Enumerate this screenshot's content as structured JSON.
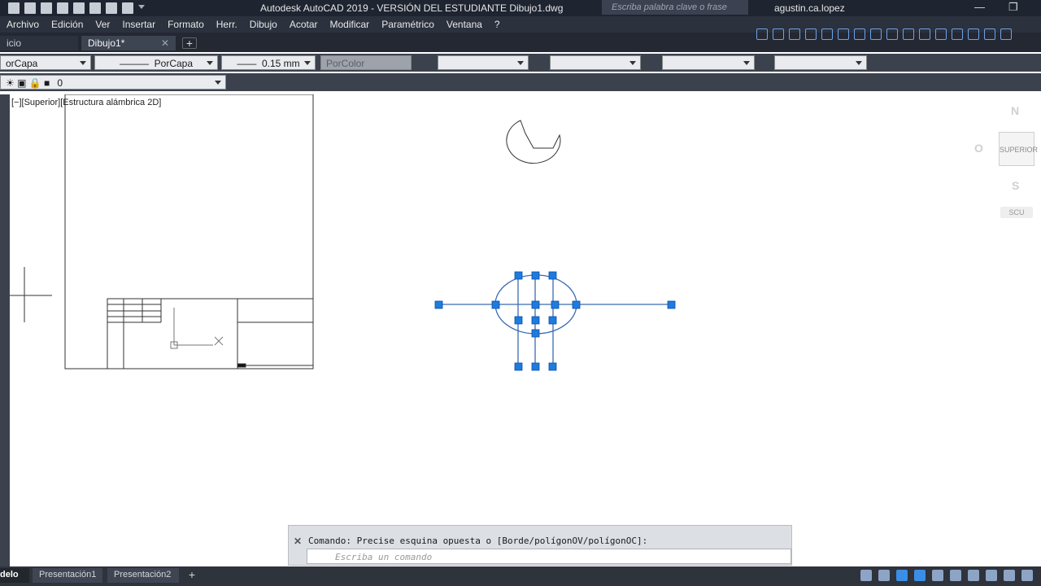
{
  "title_bar": {
    "title": "Autodesk AutoCAD 2019 - VERSIÓN DEL ESTUDIANTE    Dibujo1.dwg",
    "search_placeholder": "Escriba palabra clave o frase",
    "user": "agustin.ca.lopez"
  },
  "menu": [
    "Archivo",
    "Edición",
    "Ver",
    "Insertar",
    "Formato",
    "Herr.",
    "Dibujo",
    "Acotar",
    "Modificar",
    "Paramétrico",
    "Ventana",
    "?"
  ],
  "tabs": {
    "inicio": "icio",
    "drawing": "Dibujo1*"
  },
  "properties": {
    "color": "orCapa",
    "linetype": "PorCapa",
    "lineweight": "0.15 mm",
    "plotstyle": "PorColor"
  },
  "layer": {
    "current": "0"
  },
  "viewport": {
    "label": "[−][Superior][Estructura alámbrica 2D]"
  },
  "viewcube": {
    "north": "N",
    "south": "S",
    "west": "O",
    "face": "SUPERIOR",
    "ucs": "SCU"
  },
  "command": {
    "history": "Comando: Precise esquina opuesta o [Borde/polígonOV/polígonOC]:",
    "placeholder": "Escriba un comando"
  },
  "layout_tabs": {
    "model": "delo",
    "p1": "Presentación1",
    "p2": "Presentación2"
  },
  "colors": {
    "grip": "#1e7be0",
    "selected_line": "#3a6bb5",
    "ui_dark": "#2b313d"
  }
}
